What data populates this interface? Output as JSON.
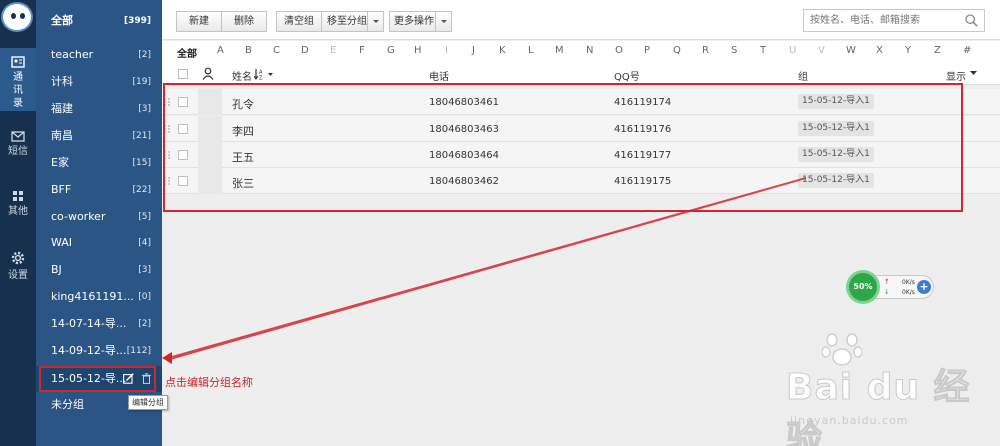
{
  "rail": {
    "items": [
      {
        "label": "通讯录",
        "icon": "contacts-icon",
        "active": true
      },
      {
        "label": "短信",
        "icon": "mail-icon"
      },
      {
        "label": "其他",
        "icon": "grid-icon"
      },
      {
        "label": "设置",
        "icon": "gear-icon"
      }
    ]
  },
  "groups": [
    {
      "label": "全部",
      "count": "[399]"
    },
    {
      "label": "teacher",
      "count": "[2]"
    },
    {
      "label": "计科",
      "count": "[19]"
    },
    {
      "label": "福建",
      "count": "[3]"
    },
    {
      "label": "南昌",
      "count": "[21]"
    },
    {
      "label": "E家",
      "count": "[15]"
    },
    {
      "label": "BFF",
      "count": "[22]"
    },
    {
      "label": "co-worker",
      "count": "[5]"
    },
    {
      "label": "WAI",
      "count": "[4]"
    },
    {
      "label": "BJ",
      "count": "[3]"
    },
    {
      "label": "king4161191...",
      "count": "[0]"
    },
    {
      "label": "14-07-14-导...",
      "count": "[2]"
    },
    {
      "label": "14-09-12-导...",
      "count": "[112]"
    },
    {
      "label": "15-05-12-导...",
      "count": ""
    },
    {
      "label": "未分组",
      "count": ""
    }
  ],
  "toolbar": {
    "new_label": "新建",
    "delete_label": "删除",
    "clear_group_label": "清空组",
    "move_to_group_label": "移至分组",
    "more_actions_label": "更多操作",
    "search_placeholder": "按姓名、电话、邮箱搜索"
  },
  "alphabet": [
    "全部",
    "A",
    "B",
    "C",
    "D",
    "E",
    "F",
    "G",
    "H",
    "I",
    "J",
    "K",
    "L",
    "M",
    "N",
    "O",
    "P",
    "Q",
    "R",
    "S",
    "T",
    "U",
    "V",
    "W",
    "X",
    "Y",
    "Z",
    "#"
  ],
  "alphabet_disabled": [
    "E",
    "I",
    "U",
    "V"
  ],
  "table": {
    "headers": {
      "name": "姓名",
      "phone": "电话",
      "qq": "QQ号",
      "group": "组",
      "display": "显示"
    },
    "rows": [
      {
        "name": "孔令",
        "phone": "18046803461",
        "qq": "416119174",
        "group": "15-05-12-导入1"
      },
      {
        "name": "李四",
        "phone": "18046803463",
        "qq": "416119176",
        "group": "15-05-12-导入1"
      },
      {
        "name": "王五",
        "phone": "18046803464",
        "qq": "416119177",
        "group": "15-05-12-导入1"
      },
      {
        "name": "张三",
        "phone": "18046803462",
        "qq": "416119175",
        "group": "15-05-12-导入1"
      }
    ]
  },
  "annotation": {
    "text": "点击编辑分组名称",
    "tooltip": "编辑分组",
    "color": "#c8252d"
  },
  "speed_widget": {
    "percent": "50%",
    "up": "0K/s",
    "down": "0K/s"
  },
  "watermark": {
    "brand": "Bai du 经验",
    "url": "jingyan.baidu.com"
  }
}
